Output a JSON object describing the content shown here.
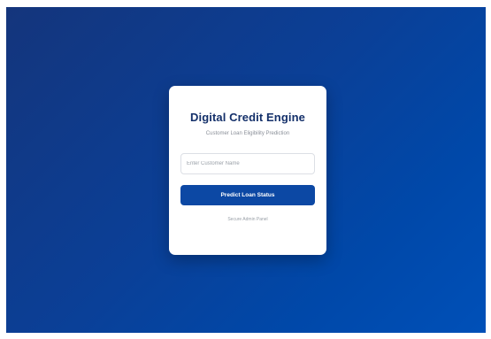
{
  "app": {
    "title": "Digital Credit Engine",
    "subtitle": "Customer Loan Eligibility Prediction"
  },
  "form": {
    "customer_name": {
      "value": "",
      "placeholder": "Enter Customer Name"
    },
    "predict_label": "Predict Loan Status"
  },
  "footer": {
    "admin_link": "Secure Admin Panel"
  },
  "colors": {
    "background_start": "#14357c",
    "background_end": "#0050b8",
    "title": "#14306a",
    "button": "#0c48a4"
  }
}
